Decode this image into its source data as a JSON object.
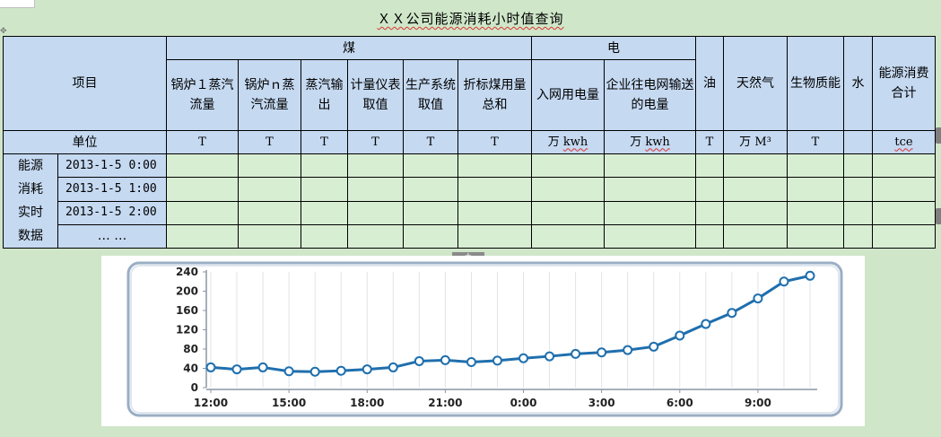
{
  "title": "ＸＸ公司能源消耗小时值查询",
  "table": {
    "header": {
      "item": "项目",
      "group_coal": "煤",
      "group_elec": "电",
      "oil": "油",
      "gas": "天然气",
      "bio": "生物质能",
      "water": "水",
      "total": "能源消费合计",
      "coal_cols": [
        "锅炉１蒸汽流量",
        "锅炉ｎ蒸汽流量",
        "蒸汽输出",
        "计量仪表取值",
        "生产系统取值",
        "折标煤用量总和"
      ],
      "elec_cols": [
        "入网用电量",
        "企业往电网输送的电量"
      ]
    },
    "units": {
      "label": "单位",
      "coal": [
        "T",
        "T",
        "T",
        "T",
        "T",
        "T"
      ],
      "elec_wan": [
        "万",
        "万"
      ],
      "elec_kwh": [
        "kwh",
        "kwh"
      ],
      "oil": "T",
      "gas_wan": "万",
      "gas_m3": "M³",
      "bio": "T",
      "water": "",
      "total": "tce"
    },
    "realtime_label": [
      "能源",
      "消耗",
      "实时",
      "数据"
    ],
    "rows": [
      "2013-1-5 0:00",
      "2013-1-5 1:00",
      "2013-1-5 2:00",
      "… …"
    ]
  },
  "plus_tab": "+",
  "chart_data": {
    "type": "line",
    "x": [
      "12:00",
      "13:00",
      "14:00",
      "15:00",
      "16:00",
      "17:00",
      "18:00",
      "19:00",
      "20:00",
      "21:00",
      "22:00",
      "23:00",
      "0:00",
      "1:00",
      "2:00",
      "3:00",
      "4:00",
      "5:00",
      "6:00",
      "7:00",
      "8:00",
      "9:00",
      "10:00",
      "11:00"
    ],
    "x_tick_labels": [
      "12:00",
      "15:00",
      "18:00",
      "21:00",
      "0:00",
      "3:00",
      "6:00",
      "9:00"
    ],
    "values": [
      42,
      38,
      42,
      34,
      33,
      35,
      38,
      42,
      55,
      57,
      53,
      56,
      61,
      65,
      70,
      73,
      78,
      85,
      108,
      132,
      155,
      185,
      220,
      232
    ],
    "y_ticks": [
      "0",
      "40",
      "80",
      "120",
      "160",
      "200",
      "240"
    ],
    "ylim": [
      0,
      240
    ],
    "title": "",
    "xlabel": "",
    "ylabel": "",
    "grid": "vertical",
    "line_color": "#1f6fae",
    "marker_fill": "#ffffff"
  }
}
